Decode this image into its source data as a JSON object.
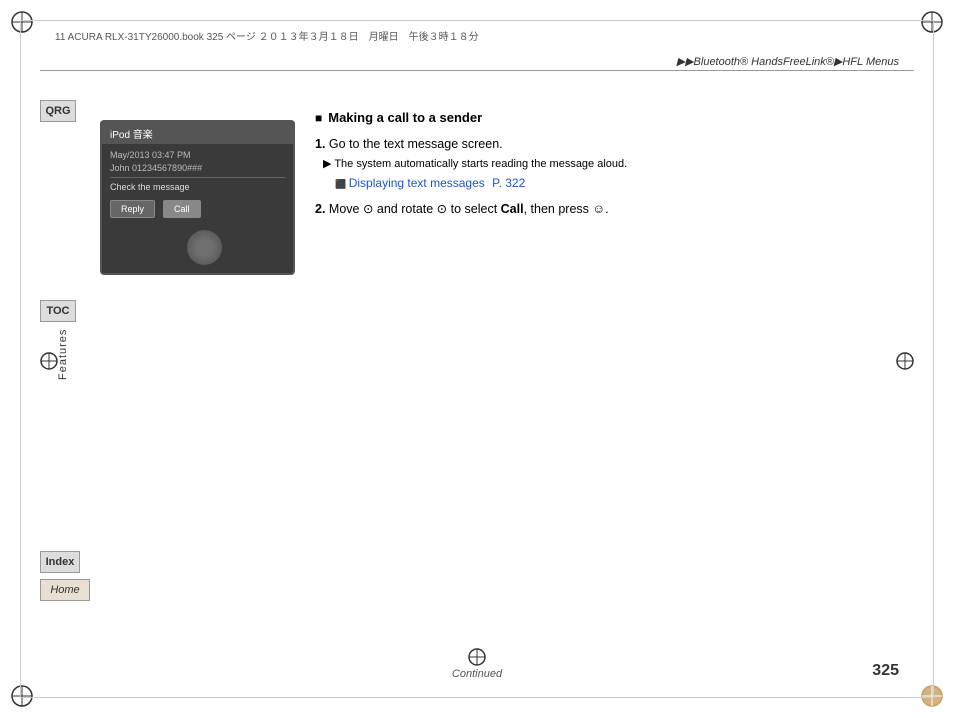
{
  "page": {
    "file_info": "11 ACURA RLX-31TY26000.book  325 ページ  ２０１３年３月１８日　月曜日　午後３時１８分",
    "header_breadcrumb": "▶▶Bluetooth® HandsFreeLink®▶HFL Menus",
    "page_number": "325",
    "footer_continued": "Continued"
  },
  "sidebar": {
    "qrg_label": "QRG",
    "toc_label": "TOC",
    "toc_vertical": "Features",
    "index_label": "Index",
    "home_label": "Home"
  },
  "screen": {
    "title": "iPod 音楽",
    "subtitle": "",
    "row1_label": "May/2013 03:47 PM",
    "row2_label": "John 01234567890###",
    "message_label": "Check the message",
    "btn_reply": "Reply",
    "btn_call": "Call"
  },
  "content": {
    "section_title": "Making a call to a sender",
    "step1_num": "1.",
    "step1_text": "Go to the text message screen.",
    "step1_sub": "The system automatically starts reading the message aloud.",
    "step1_link_text": "Displaying text messages",
    "step1_link_ref": "P. 322",
    "step2_num": "2.",
    "step2_text_pre": "Move",
    "step2_dial_symbol": "⊙",
    "step2_text_mid": "and rotate",
    "step2_rotate_symbol": "⊙",
    "step2_text_post": "to select",
    "step2_bold": "Call",
    "step2_text_end": ", then press",
    "step2_press_symbol": "☺",
    "step2_period": "."
  }
}
